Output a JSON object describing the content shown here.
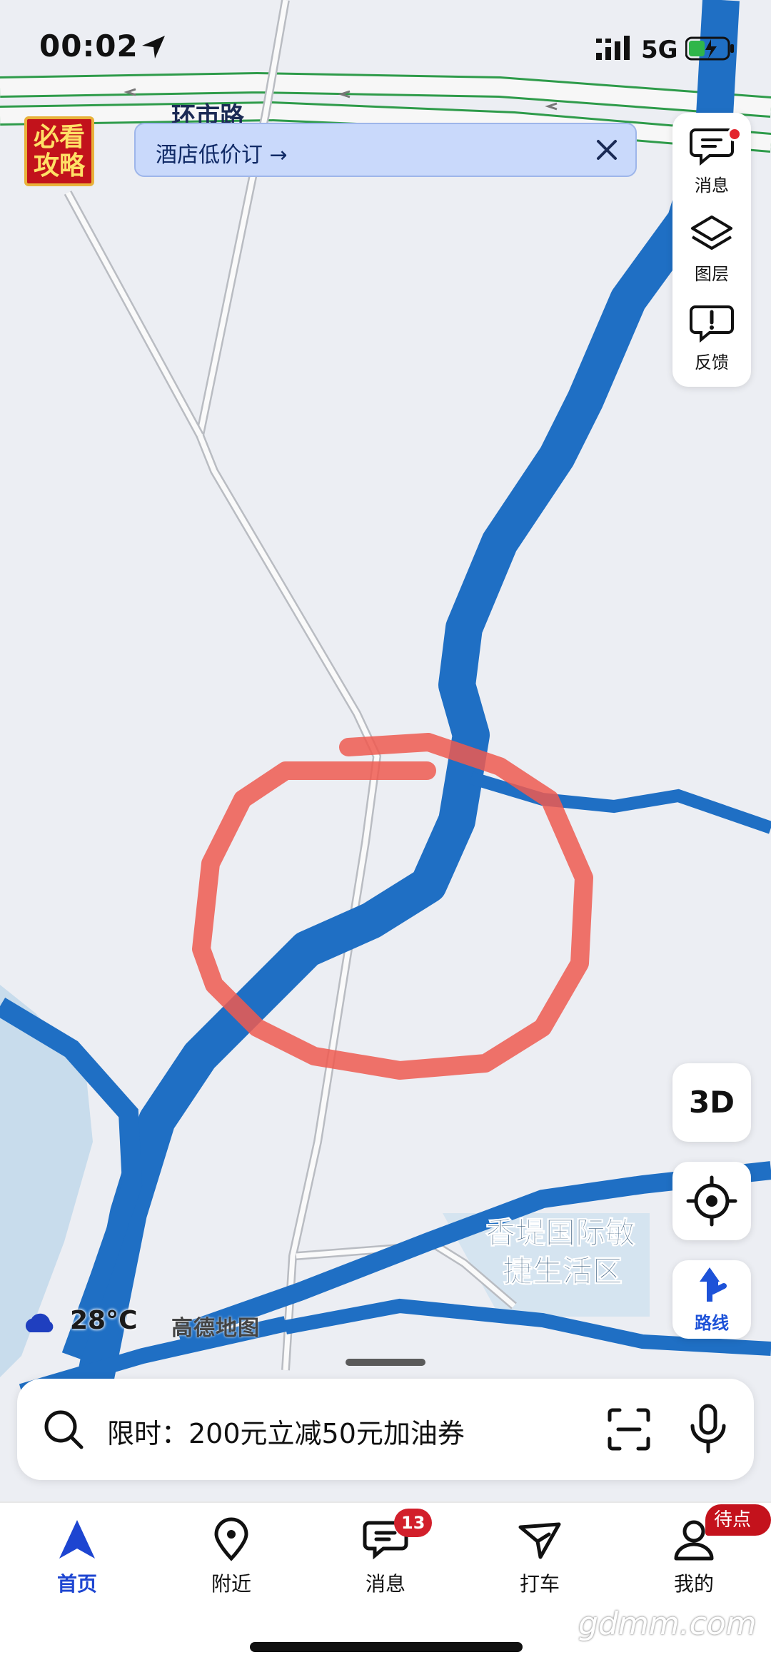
{
  "status_bar": {
    "time": "00:02",
    "network": "5G"
  },
  "map": {
    "road_label": "环市路",
    "area_label_line1": "香堤国际敏",
    "area_label_line2": "捷生活区"
  },
  "banner": {
    "badge_line1": "必看",
    "badge_line2": "攻略",
    "hotel_promo": "酒店低价订 →"
  },
  "tools": [
    {
      "label": "消息",
      "icon": "message-icon",
      "has_dot": true
    },
    {
      "label": "图层",
      "icon": "layers-icon"
    },
    {
      "label": "反馈",
      "icon": "feedback-icon"
    }
  ],
  "controls": {
    "three_d": "3D",
    "route": "路线"
  },
  "weather": {
    "temperature": "28°C",
    "icon": "cloud-icon"
  },
  "brand": "高德地图",
  "search": {
    "placeholder": "限时：200元立减50元加油券"
  },
  "tab_bar": {
    "tabs": [
      {
        "label": "首页",
        "icon": "navigation-arrow-icon",
        "active": true
      },
      {
        "label": "附近",
        "icon": "location-pin-icon"
      },
      {
        "label": "消息",
        "icon": "message-icon",
        "badge": "13"
      },
      {
        "label": "打车",
        "icon": "taxi-icon"
      },
      {
        "label": "我的",
        "icon": "user-icon",
        "badge": "待点亮"
      }
    ]
  },
  "watermark": "gdmm.com",
  "colors": {
    "river": "#1f6fc4",
    "highway_green": "#2e9b4a",
    "annotation_red": "#ee5a50",
    "active_tab": "#1d45d1",
    "badge_red": "#d21f2b"
  }
}
